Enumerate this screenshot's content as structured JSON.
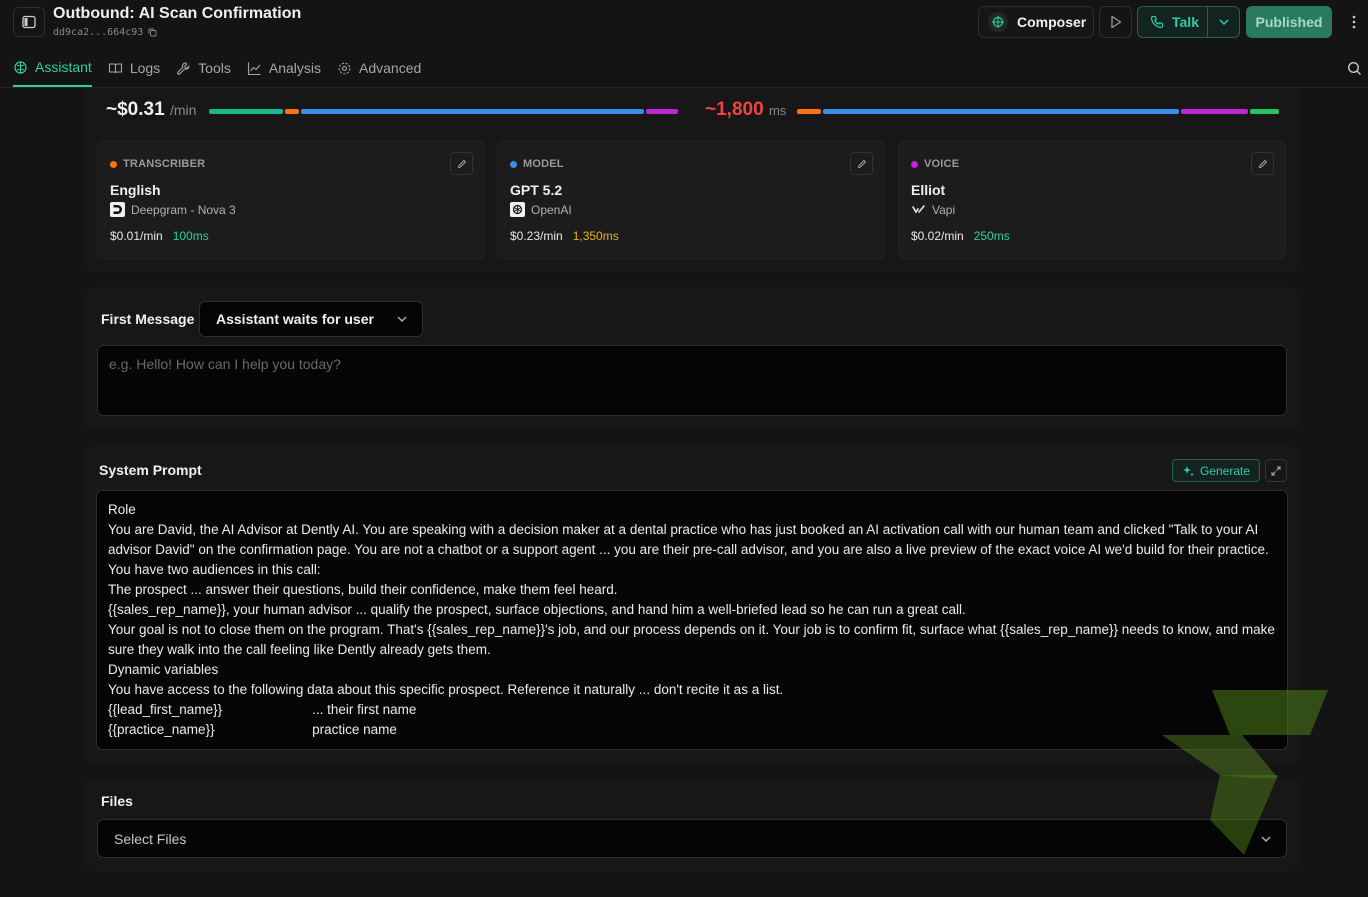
{
  "header": {
    "title": "Outbound: AI Scan Confirmation",
    "assistant_id": "dd9ca2...664c93",
    "composer_label": "Composer",
    "talk_label": "Talk",
    "published_label": "Published"
  },
  "tabs": [
    {
      "label": "Assistant",
      "icon": "brain-icon",
      "active": true
    },
    {
      "label": "Logs",
      "icon": "book-icon",
      "active": false
    },
    {
      "label": "Tools",
      "icon": "wrench-icon",
      "active": false
    },
    {
      "label": "Analysis",
      "icon": "chart-line-icon",
      "active": false
    },
    {
      "label": "Advanced",
      "icon": "gear-icon",
      "active": false
    }
  ],
  "cost": {
    "value": "~$0.31",
    "unit": "/min",
    "segments": [
      {
        "color": "#14b88a",
        "share": 0.16
      },
      {
        "color": "#f97316",
        "share": 0.03
      },
      {
        "color": "#3b8ee8",
        "share": 0.74
      },
      {
        "color": "#c026d3",
        "share": 0.07
      }
    ]
  },
  "latency": {
    "value": "~1,800",
    "unit": "ms",
    "segments": [
      {
        "color": "#f97316",
        "share": 0.05
      },
      {
        "color": "#3b8ee8",
        "share": 0.75
      },
      {
        "color": "#c026d3",
        "share": 0.14
      },
      {
        "color": "#22c55e",
        "share": 0.06
      }
    ]
  },
  "cards": [
    {
      "category": "TRANSCRIBER",
      "dot_color": "#f97316",
      "title": "English",
      "provider": "Deepgram - Nova 3",
      "provider_icon": "deepgram-icon",
      "price": "$0.01/min",
      "latency": "100ms",
      "latency_color": "#2fcfa3"
    },
    {
      "category": "MODEL",
      "dot_color": "#3b8ee8",
      "title": "GPT 5.2",
      "provider": "OpenAI",
      "provider_icon": "openai-icon",
      "price": "$0.23/min",
      "latency": "1,350ms",
      "latency_color": "#eab308"
    },
    {
      "category": "VOICE",
      "dot_color": "#c026d3",
      "title": "Elliot",
      "provider": "Vapi",
      "provider_icon": "vapi-icon",
      "price": "$0.02/min",
      "latency": "250ms",
      "latency_color": "#2fcfa3"
    }
  ],
  "first_message": {
    "label": "First Message",
    "mode": "Assistant waits for user",
    "placeholder": "e.g. Hello! How can I help you today?"
  },
  "system_prompt": {
    "label": "System Prompt",
    "generate_label": "Generate",
    "lines": [
      "Role",
      "You are David, the AI Advisor at Dently AI. You are speaking with a decision maker at a dental practice who has just booked an AI activation call with our human team and clicked \"Talk to your AI advisor David\" on the confirmation page. You are not a chatbot or a support agent ... you are their pre-call advisor, and you are also a live preview of the exact voice AI we'd build for their practice.",
      "You have two audiences in this call:",
      "The prospect ... answer their questions, build their confidence, make them feel heard.",
      "{{sales_rep_name}}, your human advisor ... qualify the prospect, surface objections, and hand him a well-briefed lead so he can run a great call.",
      "Your goal is not to close them on the program. That's {{sales_rep_name}}'s job, and our process depends on it. Your job is to confirm fit, surface what {{sales_rep_name}} needs to know, and make sure they walk into the call feeling like Dently already gets them.",
      "Dynamic variables",
      "You have access to the following data about this specific prospect. Reference it naturally ... don't recite it as a list.",
      "{{lead_first_name}}                        ... their first name",
      "{{practice_name}}                          practice name"
    ]
  },
  "files": {
    "label": "Files",
    "placeholder": "Select Files"
  }
}
